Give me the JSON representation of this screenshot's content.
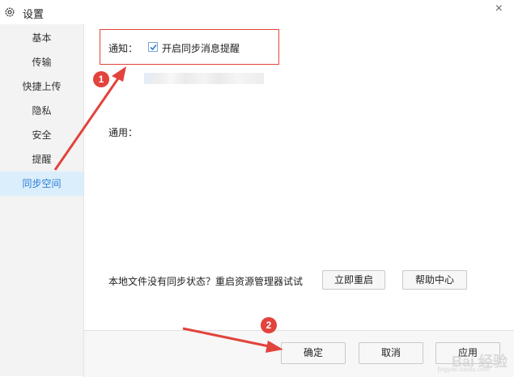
{
  "window": {
    "title": "设置",
    "close_glyph": "×"
  },
  "sidebar": {
    "items": [
      {
        "label": "基本",
        "active": false
      },
      {
        "label": "传输",
        "active": false
      },
      {
        "label": "快捷上传",
        "active": false
      },
      {
        "label": "隐私",
        "active": false
      },
      {
        "label": "安全",
        "active": false
      },
      {
        "label": "提醒",
        "active": false
      },
      {
        "label": "同步空间",
        "active": true
      }
    ]
  },
  "main": {
    "notify_label": "通知：",
    "sync_reminder_checkbox": {
      "label": "开启同步消息提醒",
      "checked": true
    },
    "general_label": "通用：",
    "sync_status_text": "本地文件没有同步状态？重启资源管理器试试",
    "restart_now_label": "立即重启",
    "help_center_label": "帮助中心"
  },
  "footer": {
    "ok_label": "确定",
    "cancel_label": "取消",
    "apply_label": "应用"
  },
  "annotations": {
    "badge_1": "1",
    "badge_2": "2",
    "accent_color": "#e2433c"
  },
  "watermark": {
    "text": "Bai 经验",
    "sub": "jingyan.baidu.com"
  },
  "icons": {
    "window_icon": "gear-icon",
    "checkbox_mark": "check-icon"
  },
  "colors": {
    "sidebar_active_bg": "#dbeefc",
    "sidebar_active_text": "#2b7fd6",
    "sidebar_bg": "#f3f3f3"
  }
}
